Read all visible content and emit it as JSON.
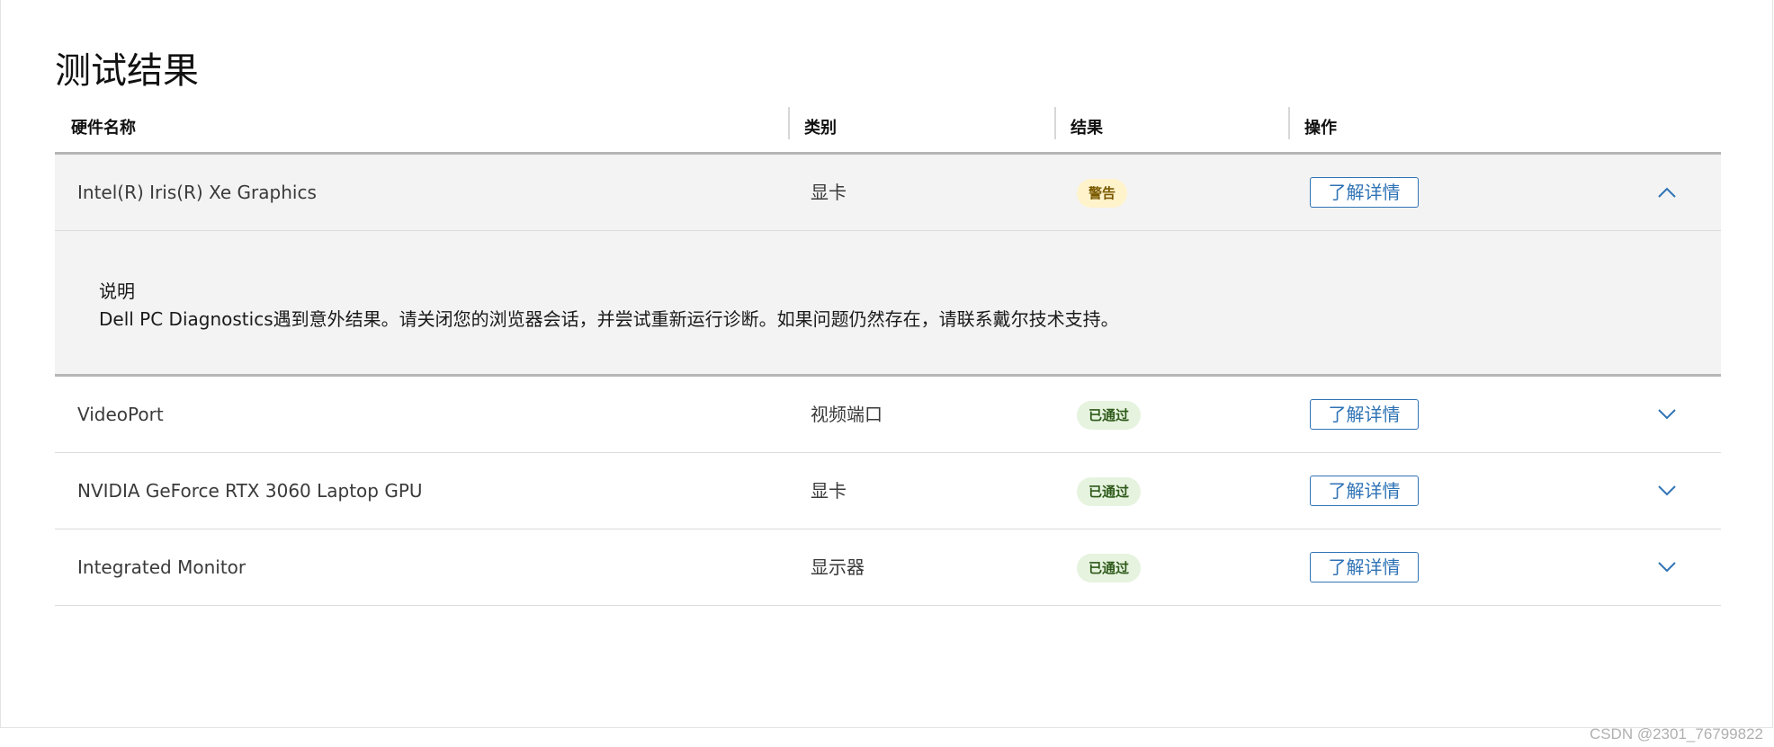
{
  "page": {
    "title": "测试结果",
    "watermark": "CSDN @2301_76799822"
  },
  "table": {
    "headers": {
      "name": "硬件名称",
      "type": "类别",
      "result": "结果",
      "action": "操作"
    },
    "rows": [
      {
        "name": "Intel(R) Iris(R) Xe Graphics",
        "type": "显卡",
        "result": "警告",
        "result_status": "warning",
        "action": "了解详情",
        "expanded": true,
        "chevron_icon": "chevron-up-icon",
        "detail_label": "说明",
        "detail_text": "Dell PC Diagnostics遇到意外结果。请关闭您的浏览器会话，并尝试重新运行诊断。如果问题仍然存在，请联系戴尔技术支持。"
      },
      {
        "name": "VideoPort",
        "type": "视频端口",
        "result": "已通过",
        "result_status": "passed",
        "action": "了解详情",
        "expanded": false,
        "chevron_icon": "chevron-down-icon"
      },
      {
        "name": "NVIDIA GeForce RTX 3060 Laptop GPU",
        "type": "显卡",
        "result": "已通过",
        "result_status": "passed",
        "action": "了解详情",
        "expanded": false,
        "chevron_icon": "chevron-down-icon"
      },
      {
        "name": "Integrated Monitor",
        "type": "显示器",
        "result": "已通过",
        "result_status": "passed",
        "action": "了解详情",
        "expanded": false,
        "chevron_icon": "chevron-down-icon"
      }
    ]
  },
  "colors": {
    "accent": "#2f73b5",
    "warning_bg": "#fff3cc",
    "passed_bg": "#e6f3df",
    "expanded_bg": "#f3f3f3"
  }
}
